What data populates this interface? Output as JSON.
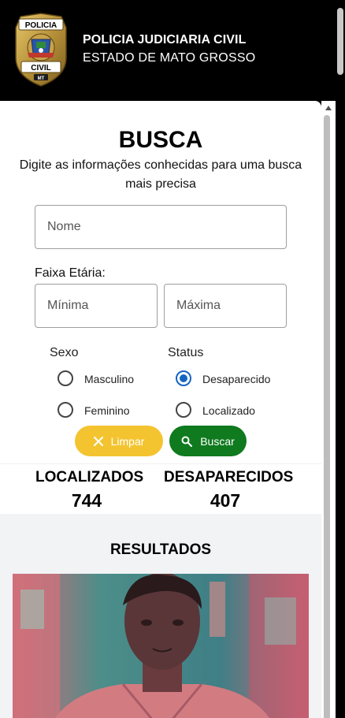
{
  "header": {
    "badge": {
      "top_text": "POLICIA",
      "bottom_text": "CIVIL",
      "state_text": "MT"
    },
    "title": "POLICIA JUDICIARIA CIVIL",
    "subtitle": "ESTADO DE MATO GROSSO"
  },
  "search": {
    "title": "BUSCA",
    "subtitle": "Digite as informações conhecidas para uma busca mais precisa",
    "name_placeholder": "Nome",
    "age_label": "Faixa Etária:",
    "min_placeholder": "Mínima",
    "max_placeholder": "Máxima",
    "sex": {
      "label": "Sexo",
      "options": [
        "Masculino",
        "Feminino"
      ],
      "selected": null
    },
    "status": {
      "label": "Status",
      "options": [
        "Desaparecido",
        "Localizado"
      ],
      "selected": "Desaparecido"
    },
    "clear_label": "Limpar",
    "search_label": "Buscar"
  },
  "stats": {
    "found_label": "LOCALIZADOS",
    "found_value": "744",
    "missing_label": "DESAPARECIDOS",
    "missing_value": "407"
  },
  "results": {
    "title": "RESULTADOS"
  },
  "colors": {
    "header_bg": "#000000",
    "clear_button": "#f4c430",
    "search_button": "#0f7a1e",
    "radio_accent": "#1565c0",
    "results_bg": "#f1f3f5"
  },
  "icons": {
    "clear": "close-icon",
    "search": "search-icon"
  }
}
